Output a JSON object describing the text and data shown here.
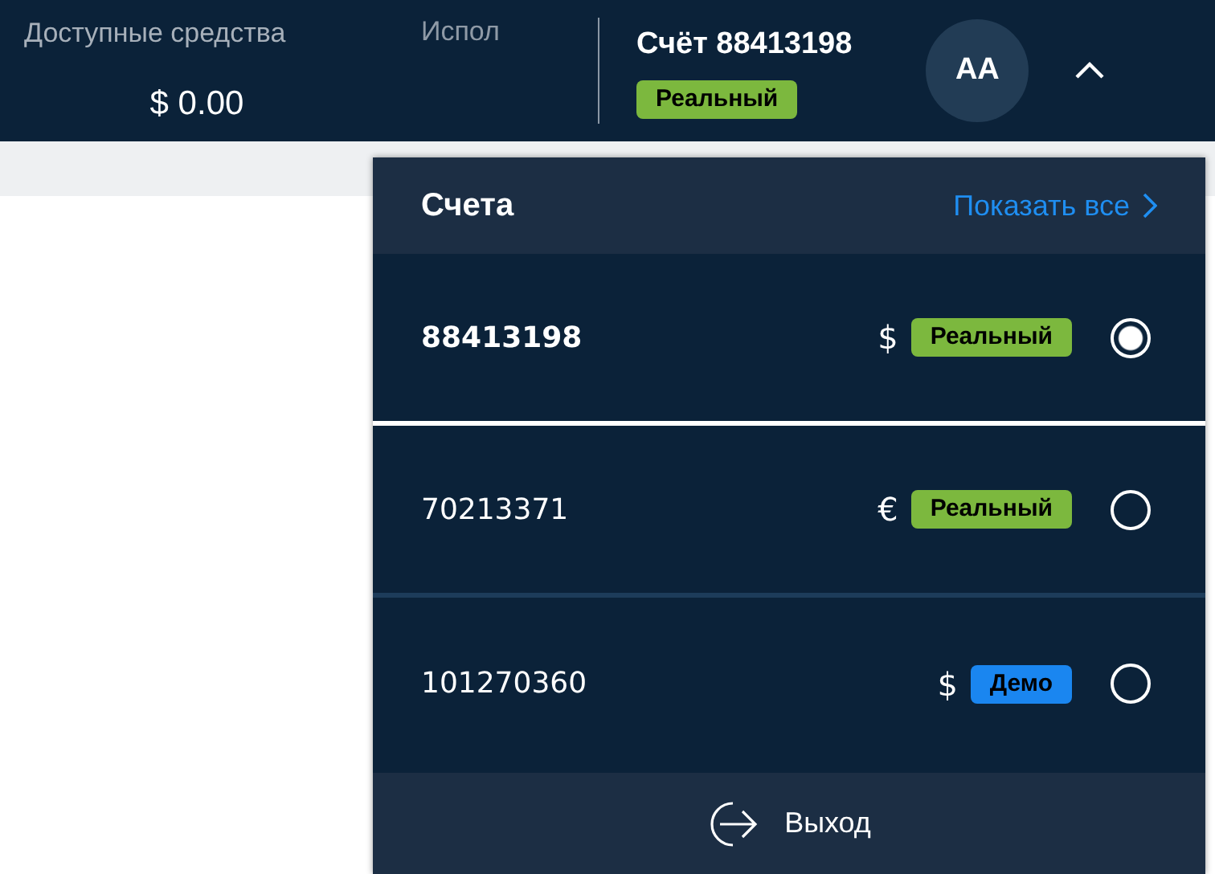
{
  "header": {
    "funds_label": "Доступные средства",
    "funds_value": "$ 0.00",
    "used_label": "Испол",
    "account_title": "Счёт 88413198",
    "account_badge": {
      "label": "Реальный",
      "kind": "real"
    },
    "avatar": "AA",
    "expanded": true
  },
  "accounts_panel": {
    "title": "Счета",
    "show_all": "Показать все",
    "accounts": [
      {
        "number": "88413198",
        "currency": "$",
        "badge": {
          "label": "Реальный",
          "kind": "real"
        },
        "selected": true
      },
      {
        "number": "70213371",
        "currency": "€",
        "badge": {
          "label": "Реальный",
          "kind": "real"
        },
        "selected": false
      },
      {
        "number": "101270360",
        "currency": "$",
        "badge": {
          "label": "Демо",
          "kind": "demo"
        },
        "selected": false
      }
    ],
    "logout": "Выход"
  }
}
